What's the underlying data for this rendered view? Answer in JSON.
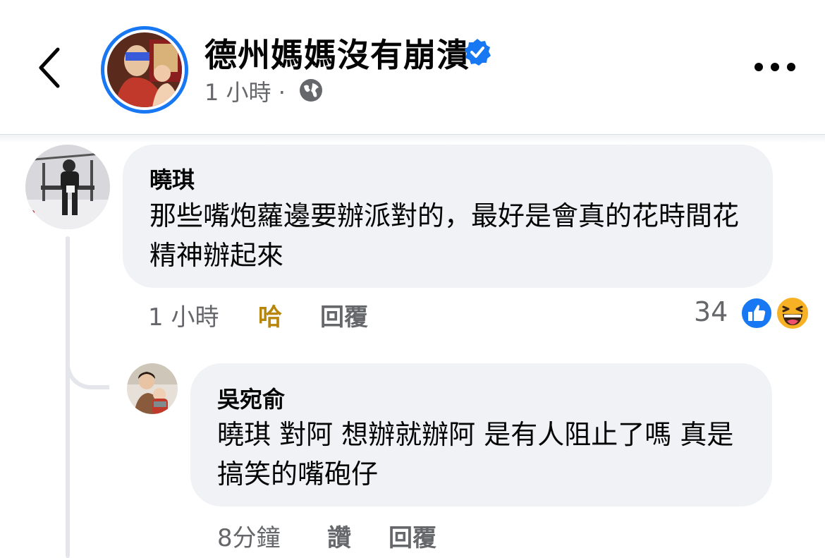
{
  "header": {
    "page_name": "德州媽媽沒有崩潰",
    "meta_time": "1 小時",
    "meta_separator": "·"
  },
  "comments": [
    {
      "author": "曉琪",
      "text": "那些嘴炮蘿邊要辦派對的，最好是會真的花時間花精神辦起來",
      "time": "1 小時",
      "reaction_action": "哈",
      "reply_label": "回覆",
      "reaction_count": "34"
    },
    {
      "author": "吳宛俞",
      "text": "曉琪 對阿 想辦就辦阿 是有人阻止了嗎 真是搞笑的嘴砲仔",
      "time": "8分鐘",
      "like_label": "讚",
      "reply_label": "回覆"
    }
  ],
  "colors": {
    "accent": "#1877f2",
    "bubble": "#f0f2f5",
    "secondary_text": "#65676b",
    "haha_active": "#b8860b"
  }
}
